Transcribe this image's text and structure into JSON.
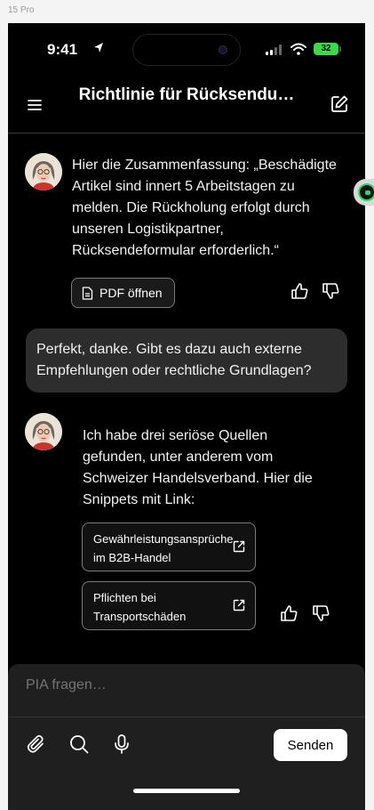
{
  "frame": {
    "device_label": "15 Pro"
  },
  "status_bar": {
    "time": "9:41",
    "battery": "32"
  },
  "header": {
    "title": "Richtlinie für Rücksendu…"
  },
  "chat": {
    "assistant_1": {
      "text": "Hier die Zusammenfassung: „Beschädigte Artikel sind innert 5 Arbeitstagen zu melden. Die Rückholung erfolgt durch unseren Logistikpartner, Rücksendeformular erforderlich.“",
      "pdf_button": "PDF öffnen"
    },
    "user_1": {
      "text": "Perfekt, danke. Gibt es dazu auch externe Empfehlungen oder rechtliche Grundlagen?"
    },
    "assistant_2": {
      "text": "Ich habe drei seriöse Quellen gefunden, unter anderem vom Schweizer Handelsverband. Hier die Snippets mit Link:",
      "links": [
        {
          "label": "Gewährleistungsansprüche im B2B-Handel"
        },
        {
          "label": "Pflichten bei Transportschäden"
        }
      ]
    }
  },
  "composer": {
    "placeholder": "PIA fragen…",
    "send_label": "Senden"
  },
  "icons": {
    "menu": "hamburger-menu-icon",
    "edit": "edit-icon",
    "document": "document-icon",
    "thumbs_up": "thumbs-up-icon",
    "thumbs_down": "thumbs-down-icon",
    "external_link": "external-link-icon",
    "attach": "paperclip-icon",
    "search": "search-icon",
    "microphone": "microphone-icon"
  },
  "colors": {
    "background": "#000000",
    "user_bubble": "#2d2d2d",
    "composer": "#1f1f1f",
    "battery": "#3adb4a",
    "send_button": "#ffffff"
  }
}
